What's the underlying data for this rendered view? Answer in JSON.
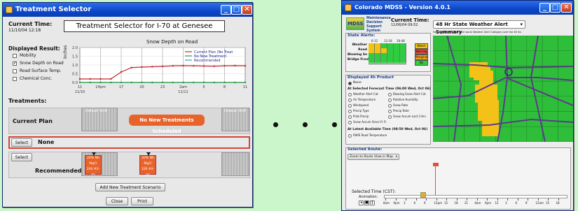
{
  "left_window": {
    "title": "Treatment Selector",
    "current_time_label": "Current Time:",
    "current_time_value": "11/10/04 12:18",
    "heading": "Treatment Selector for I-70 at Genesee",
    "chart_title": "Snow Depth on Road",
    "displayed_result_label": "Displayed Result:",
    "displayed_results": [
      {
        "label": "Mobility",
        "checked": false
      },
      {
        "label": "Snow Depth on Road",
        "checked": true
      },
      {
        "label": "Road Surface Temp.",
        "checked": false
      },
      {
        "label": "Chemical Conc.",
        "checked": false
      }
    ],
    "treatments_label": "Treatments:",
    "current_plan_label": "Current Plan",
    "default_shift_1": "Default Shift",
    "default_shift_2": "Default Shift",
    "no_treatments_label": "No New Treatments Scheduled",
    "select_button_1": "Select",
    "none_label": "None",
    "select_button_2": "Select",
    "recommended_label": "Recommended",
    "treatment_blocks": [
      {
        "line1": "20% Nh",
        "line2": "MgCl",
        "line3": "200 #/l-mi"
      },
      {
        "line1": "20% Nh",
        "line2": "MgCl",
        "line3": "100 #/l-mi"
      }
    ],
    "add_scenario_button": "Add New Treatment Scenario",
    "close_button": "Close",
    "print_button": "Print",
    "colors": {
      "accent": "#e8632a",
      "current_plan": "#c0272d",
      "no_new": "#2e9e3e",
      "recommended": "#4a90e2"
    }
  },
  "chart_data": {
    "type": "line",
    "title": "Snow Depth on Road",
    "ylabel": "inches",
    "ylim": [
      0,
      2.0
    ],
    "yticks": [
      "2.0",
      "1.5",
      "1.0",
      "0.5",
      "0.0"
    ],
    "xticks": [
      "11",
      "14pm",
      "17",
      "20",
      "23",
      "2am",
      "5",
      "8",
      "11"
    ],
    "xdates": [
      "11/10",
      "11/11"
    ],
    "series": [
      {
        "name": "Current Plan (No Treat",
        "color": "#c0272d",
        "x": [
          0,
          0.5,
          1,
          1.5,
          2,
          2.5,
          3,
          3.5,
          4,
          4.5,
          5,
          5.5,
          6,
          6.5,
          7,
          7.5,
          8
        ],
        "values": [
          0.2,
          0.2,
          0.2,
          0.2,
          0.6,
          0.85,
          0.88,
          0.9,
          0.92,
          0.95,
          0.96,
          0.95,
          0.94,
          0.93,
          0.95,
          0.96,
          0.95
        ]
      },
      {
        "name": "No New Treatment",
        "color": "#2e9e3e",
        "x": [
          0,
          8
        ],
        "values": [
          0.0,
          0.0
        ]
      },
      {
        "name": "Recommended",
        "color": "#4a90e2",
        "x": [
          0,
          8
        ],
        "values": [
          0.0,
          0.0
        ]
      }
    ],
    "grid": true,
    "legend_placement": "top-right"
  },
  "right_window": {
    "title": "Colorado MDSS - Version 4.0.1",
    "logo": "MDSS",
    "logo_lines": [
      "Maintenance",
      "Decision",
      "Support",
      "System"
    ],
    "current_time_label": "Current Time:",
    "current_time_value": "11/06/04 09:52",
    "summary_dropdown": "48 Hr State Weather Alert Summary",
    "map_caption": "Forecast Areas show their worst Weather Alert Category over the 48 hrs",
    "state_alerts_label": "State Alerts:",
    "alert_rows": [
      "Weather",
      "Road",
      "Blowing Sn",
      "Bridge Frost"
    ],
    "alert_times": [
      "6-12",
      "12-18",
      "18-48"
    ],
    "legend": [
      {
        "label": "Watch",
        "color": "#f1c40f"
      },
      {
        "label": "Warning",
        "color": "#e74c3c"
      },
      {
        "label": "Marginal",
        "color": "#f5a623"
      },
      {
        "label": "No",
        "color": "#2ecc40"
      }
    ],
    "displayed_product_label": "Displayed 4h Product",
    "none_option": "None",
    "forecast_header": "At Selected Forecast Time (06:00 Wed, Oct 06)",
    "forecast_options": [
      "Weather Alert Cat",
      "Blowing Snow Alert Cat",
      "Air Temperature",
      "Relative Humidity",
      "Windspeed",
      "Snow Rate",
      "Precip Type",
      "Precip Rate",
      "Prob Precip",
      "Snow Accum Last 3 Hrs",
      "Snow Accum Since Fr Fr"
    ],
    "latest_header": "At Latest Available Time (08:50 Wed, Oct 06)",
    "latest_option": "RWIS Road Temperature",
    "selected_route_label": "Selected Route:",
    "route_button": "Zoom to Route View in Map",
    "selected_time_label": "Selected Time (CST):",
    "animation_label": "Animation:",
    "timeline_ticks": [
      "8am",
      "9pm",
      "3",
      "6",
      "9",
      "12pm",
      "15",
      "18",
      "21",
      "6am",
      "9pm",
      "12",
      "3",
      "6",
      "9",
      "12am",
      "15",
      "18"
    ]
  },
  "ellipsis_count": 3
}
